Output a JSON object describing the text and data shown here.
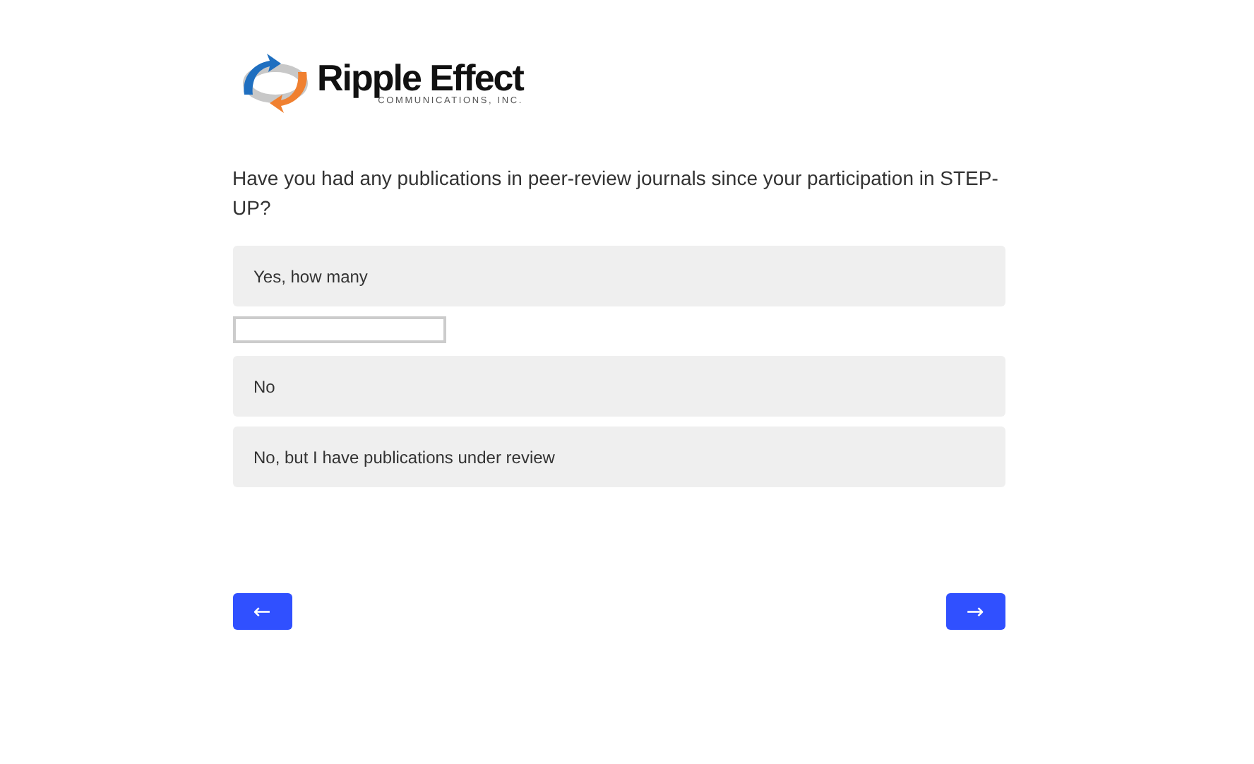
{
  "logo": {
    "name": "Ripple Effect",
    "tagline": "COMMUNICATIONS, INC."
  },
  "question": "Have you had any publications in peer-review journals since your participation in STEP-UP?",
  "answers": [
    {
      "kind": "choice",
      "label": "Yes, how many",
      "selected": false
    },
    {
      "kind": "text_input"
    },
    {
      "kind": "choice",
      "label": "No",
      "selected": false
    },
    {
      "kind": "choice",
      "label": "No, but I have publications under review",
      "selected": false
    }
  ],
  "navigation": {
    "back": "←",
    "next": "→"
  }
}
